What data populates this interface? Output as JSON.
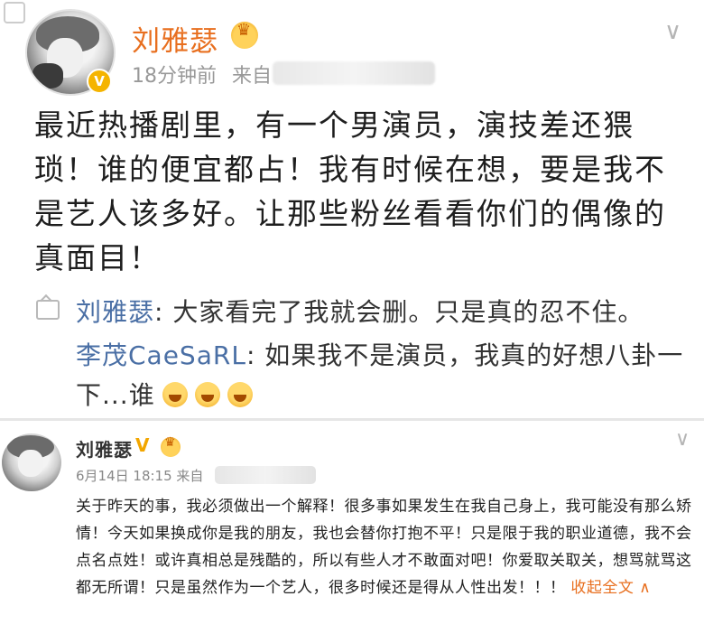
{
  "post1": {
    "author": "刘雅瑟",
    "time": "18分钟前",
    "source_prefix": "来自",
    "text": "最近热播剧里，有一个男演员，演技差还猥琐！谁的便宜都占！我有时候在想，要是我不是艺人该多好。让那些粉丝看看你们的偶像的真面目！",
    "comments": [
      {
        "name": "刘雅瑟",
        "text": ": 大家看完了我就会删。只是真的忍不住。"
      },
      {
        "name": "李茂CaeSaRL",
        "text": ": 如果我不是演员，我真的好想八卦一下...谁"
      }
    ],
    "chevron": "∨"
  },
  "post2": {
    "author": "刘雅瑟",
    "verified": "V",
    "time": "6月14日 18:15 来自",
    "text": "关于昨天的事，我必须做出一个解释！很多事如果发生在我自己身上，我可能没有那么矫情！今天如果换成你是我的朋友，我也会替你打抱不平！只是限于我的职业道德，我不会点名点姓！或许真相总是残酷的，所以有些人才不敢面对吧！你爱取关取关，想骂就骂这都无所谓！只是虽然作为一个艺人，很多时候还是得从人性出发！！！",
    "collapse": "收起全文 ∧",
    "chevron": "∨"
  },
  "colors": {
    "accent": "#e86f1f",
    "link": "#4a6fa5",
    "badge": "#f5b400"
  }
}
